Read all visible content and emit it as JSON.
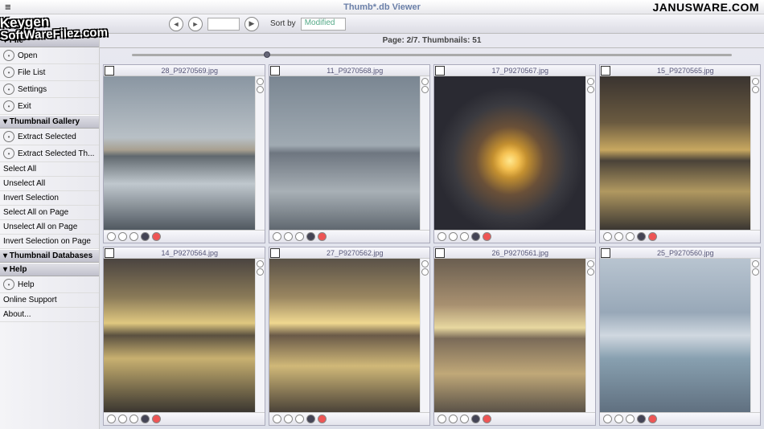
{
  "header": {
    "title": "Thumb*.db Viewer",
    "brand": "JANUSWARE.COM"
  },
  "watermark": {
    "line1": "Keygen",
    "line2": "SoftWareFilez.com"
  },
  "toolbar": {
    "sort_label": "Sort by",
    "sort_value": "Modified"
  },
  "page_info": "Page: 2/7. Thumbnails: 51",
  "sidebar": {
    "sections": [
      {
        "header": "File",
        "items": [
          {
            "label": "Open"
          },
          {
            "label": "File List"
          },
          {
            "label": "Settings"
          },
          {
            "label": "Exit"
          }
        ]
      },
      {
        "header": "Thumbnail Gallery",
        "items": [
          {
            "label": "Extract Selected"
          },
          {
            "label": "Extract Selected Th..."
          },
          {
            "label": "Select All"
          },
          {
            "label": "Unselect All"
          },
          {
            "label": "Invert Selection"
          },
          {
            "label": "Select All on Page"
          },
          {
            "label": "Unselect All on Page"
          },
          {
            "label": "Invert Selection on Page"
          }
        ]
      },
      {
        "header": "Thumbnail Databases",
        "items": []
      },
      {
        "header": "Help",
        "items": [
          {
            "label": "Help"
          },
          {
            "label": "Online Support"
          },
          {
            "label": "About..."
          }
        ]
      }
    ]
  },
  "thumbnails": [
    {
      "filename": "28_P9270569.jpg",
      "sky": "sky1"
    },
    {
      "filename": "11_P9270568.jpg",
      "sky": "sky2"
    },
    {
      "filename": "17_P9270567.jpg",
      "sky": "sky3"
    },
    {
      "filename": "15_P9270565.jpg",
      "sky": "sky4"
    },
    {
      "filename": "14_P9270564.jpg",
      "sky": "sky5"
    },
    {
      "filename": "27_P9270562.jpg",
      "sky": "sky6"
    },
    {
      "filename": "26_P9270561.jpg",
      "sky": "sky7"
    },
    {
      "filename": "25_P9270560.jpg",
      "sky": "sky8"
    }
  ]
}
